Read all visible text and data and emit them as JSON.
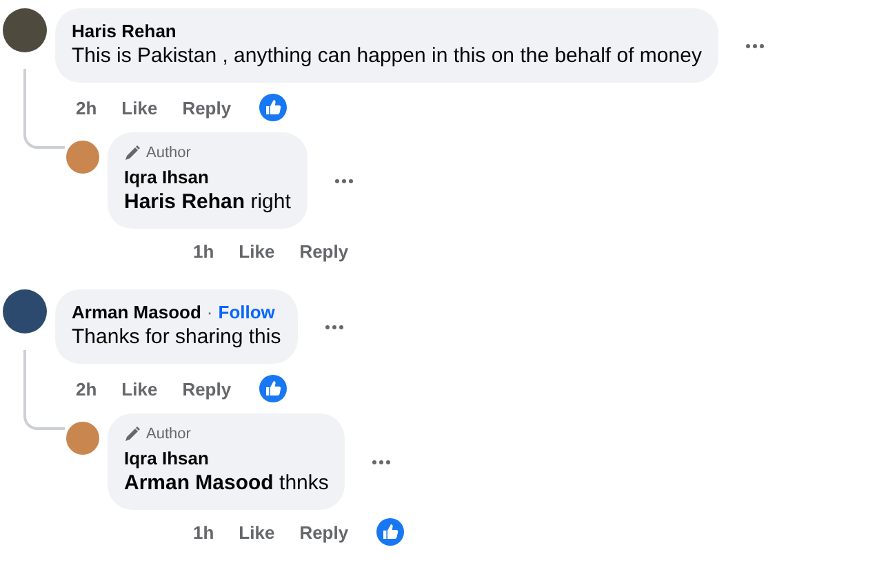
{
  "comments": [
    {
      "name": "Haris Rehan",
      "text": "This is Pakistan , anything can happen in this on the behalf of money",
      "time": "2h",
      "like": "Like",
      "reply": "Reply",
      "reacted": true,
      "replies": [
        {
          "badge": "Author",
          "name": "Iqra Ihsan",
          "mention": "Haris Rehan",
          "text": "right",
          "time": "1h",
          "like": "Like",
          "reply": "Reply",
          "reacted": false
        }
      ]
    },
    {
      "name": "Arman Masood",
      "follow": {
        "separator": "·",
        "label": "Follow"
      },
      "text": "Thanks for sharing this",
      "time": "2h",
      "like": "Like",
      "reply": "Reply",
      "reacted": true,
      "replies": [
        {
          "badge": "Author",
          "name": "Iqra Ihsan",
          "mention": "Arman Masood",
          "text": "thnks",
          "time": "1h",
          "like": "Like",
          "reply": "Reply",
          "reacted": true
        }
      ]
    }
  ]
}
